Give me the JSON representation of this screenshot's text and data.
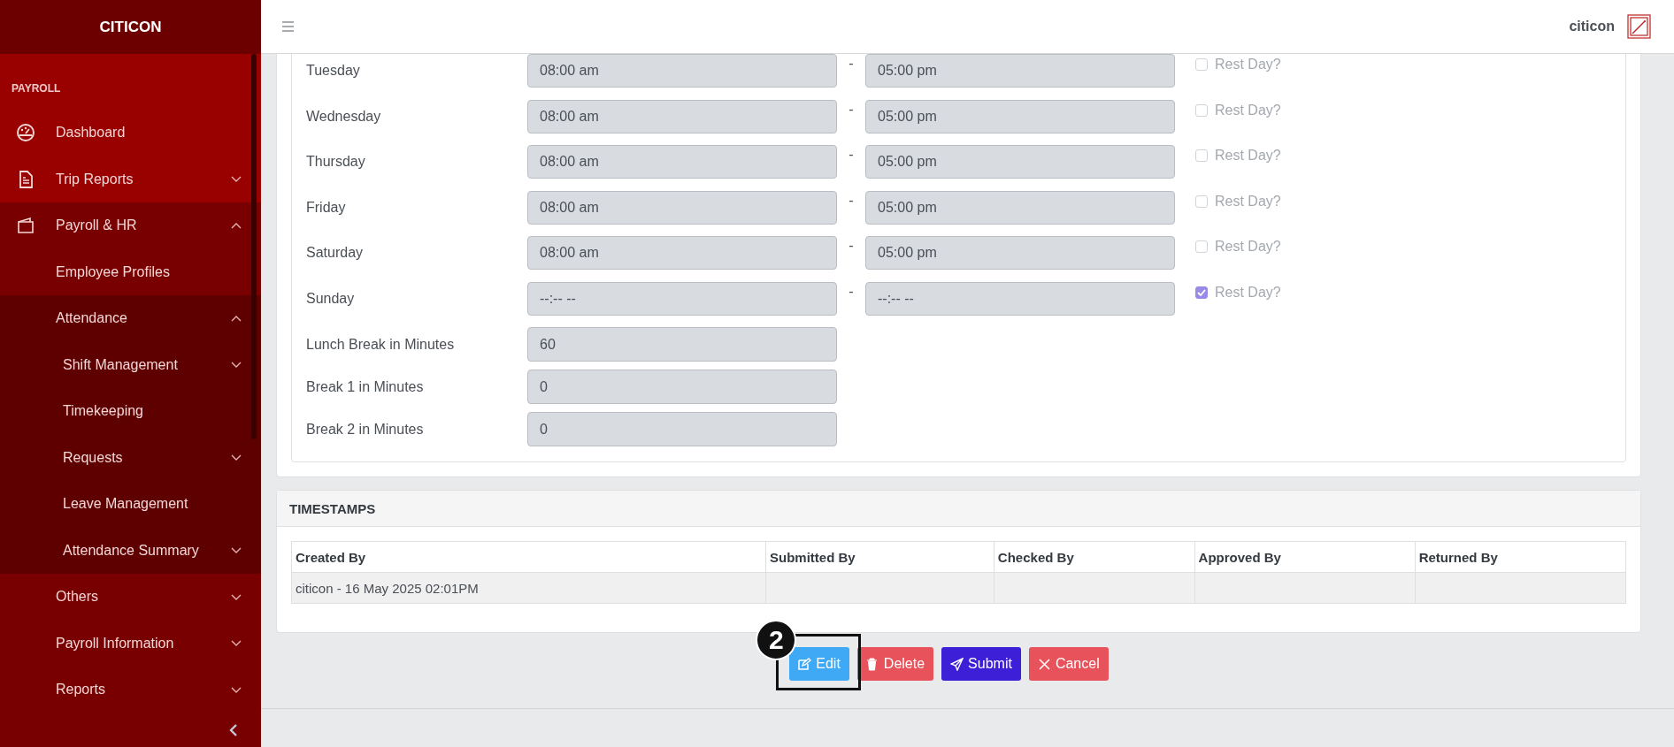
{
  "sidebar": {
    "brand": "CITICON",
    "section": "PAYROLL",
    "items": [
      {
        "label": "Dashboard",
        "kind": "link"
      },
      {
        "label": "Trip Reports",
        "kind": "group",
        "expanded": false
      },
      {
        "label": "Payroll & HR",
        "kind": "group",
        "expanded": true,
        "children": [
          {
            "label": "Employee Profiles",
            "kind": "link"
          },
          {
            "label": "Attendance",
            "kind": "group",
            "expanded": true,
            "children": [
              {
                "label": "Shift Management",
                "kind": "group",
                "expanded": false
              },
              {
                "label": "Timekeeping",
                "kind": "link"
              },
              {
                "label": "Requests",
                "kind": "group",
                "expanded": false
              },
              {
                "label": "Leave Management",
                "kind": "link"
              },
              {
                "label": "Attendance Summary",
                "kind": "group",
                "expanded": false
              }
            ]
          },
          {
            "label": "Others",
            "kind": "group",
            "expanded": false
          },
          {
            "label": "Payroll Information",
            "kind": "group",
            "expanded": false
          },
          {
            "label": "Reports",
            "kind": "group",
            "expanded": false
          }
        ]
      }
    ]
  },
  "topbar": {
    "user": "citicon"
  },
  "schedule": {
    "days": [
      {
        "label": "Tuesday",
        "start": "08:00 am",
        "separator": "-",
        "end": "05:00 pm",
        "rest_label": "Rest Day?",
        "rest_day": false
      },
      {
        "label": "Wednesday",
        "start": "08:00 am",
        "separator": "-",
        "end": "05:00 pm",
        "rest_label": "Rest Day?",
        "rest_day": false
      },
      {
        "label": "Thursday",
        "start": "08:00 am",
        "separator": "-",
        "end": "05:00 pm",
        "rest_label": "Rest Day?",
        "rest_day": false
      },
      {
        "label": "Friday",
        "start": "08:00 am",
        "separator": "-",
        "end": "05:00 pm",
        "rest_label": "Rest Day?",
        "rest_day": false
      },
      {
        "label": "Saturday",
        "start": "08:00 am",
        "separator": "-",
        "end": "05:00 pm",
        "rest_label": "Rest Day?",
        "rest_day": false
      },
      {
        "label": "Sunday",
        "start": "--:-- --",
        "separator": "-",
        "end": "--:-- --",
        "rest_label": "Rest Day?",
        "rest_day": true
      }
    ],
    "breaks": [
      {
        "label": "Lunch Break in Minutes",
        "value": "60"
      },
      {
        "label": "Break 1 in Minutes",
        "value": "0"
      },
      {
        "label": "Break 2 in Minutes",
        "value": "0"
      }
    ]
  },
  "timestamps": {
    "title": "TIMESTAMPS",
    "columns": [
      "Created By",
      "Submitted By",
      "Checked By",
      "Approved By",
      "Returned By"
    ],
    "rows": [
      {
        "created_by": "citicon - 16 May 2025 02:01PM"
      }
    ]
  },
  "buttons": [
    {
      "label": "Edit",
      "kind": "edit",
      "callout": "2"
    },
    {
      "label": "Delete",
      "kind": "delete"
    },
    {
      "label": "Submit",
      "kind": "submit"
    },
    {
      "label": "Cancel",
      "kind": "cancel"
    }
  ]
}
